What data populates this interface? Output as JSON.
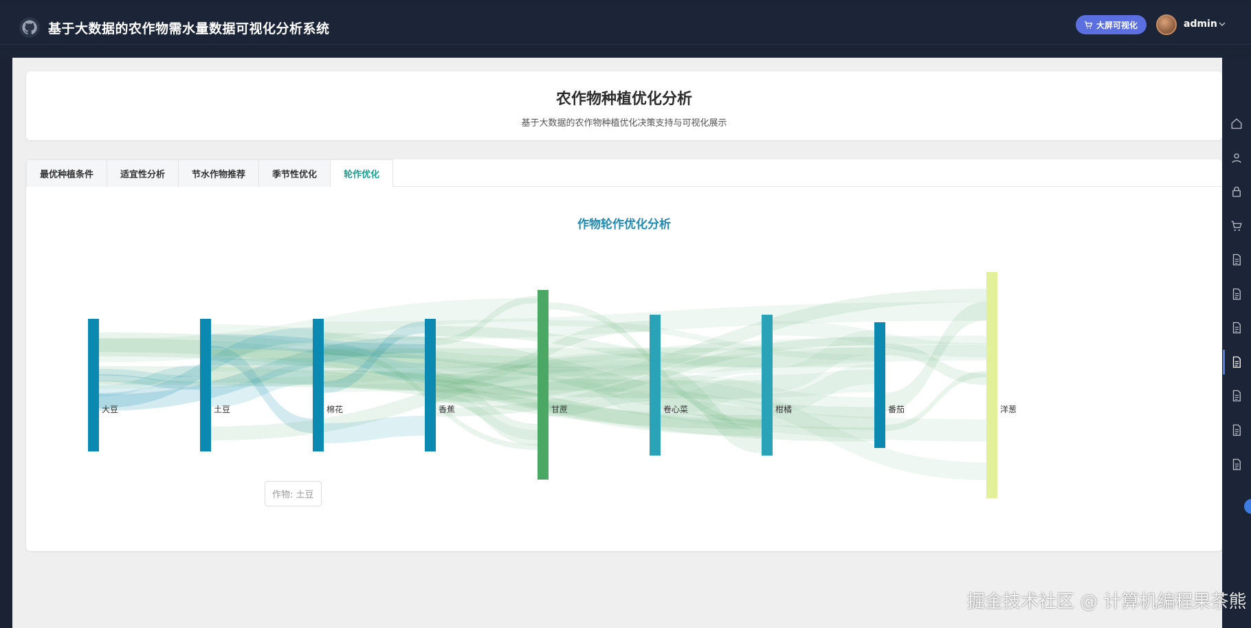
{
  "header": {
    "title": "基于大数据的农作物需水量数据可视化分析系统",
    "bigscreen_label": "大屏可视化",
    "username": "admin"
  },
  "hero": {
    "title": "农作物种植优化分析",
    "subtitle": "基于大数据的农作物种植优化决策支持与可视化展示"
  },
  "tabs": [
    {
      "label": "最优种植条件",
      "active": false
    },
    {
      "label": "适宜性分析",
      "active": false
    },
    {
      "label": "节水作物推荐",
      "active": false
    },
    {
      "label": "季节性优化",
      "active": false
    },
    {
      "label": "轮作优化",
      "active": true
    }
  ],
  "chart": {
    "title": "作物轮作优化分析",
    "tooltip": "作物: 土豆"
  },
  "chart_data": {
    "type": "sankey",
    "title": "作物轮作优化分析",
    "nodes": [
      "大豆",
      "土豆",
      "棉花",
      "香蕉",
      "甘蔗",
      "卷心菜",
      "柑橘",
      "番茄",
      "洋葱"
    ],
    "colors": {
      "primary": "#0b89b0",
      "sugarcane": "#4aa864",
      "cabbage": "#2aa3b8",
      "onion": "#e2f199"
    }
  },
  "watermark": "掘金技术社区 @ 计算机编程果茶熊",
  "icons": {
    "logo": "github-icon",
    "right_toolbar": [
      "home-icon",
      "user-icon",
      "lock-icon",
      "cart-icon",
      "doc-icon",
      "doc-icon",
      "doc-icon",
      "doc-icon",
      "doc-icon",
      "doc-icon",
      "doc-icon"
    ]
  }
}
